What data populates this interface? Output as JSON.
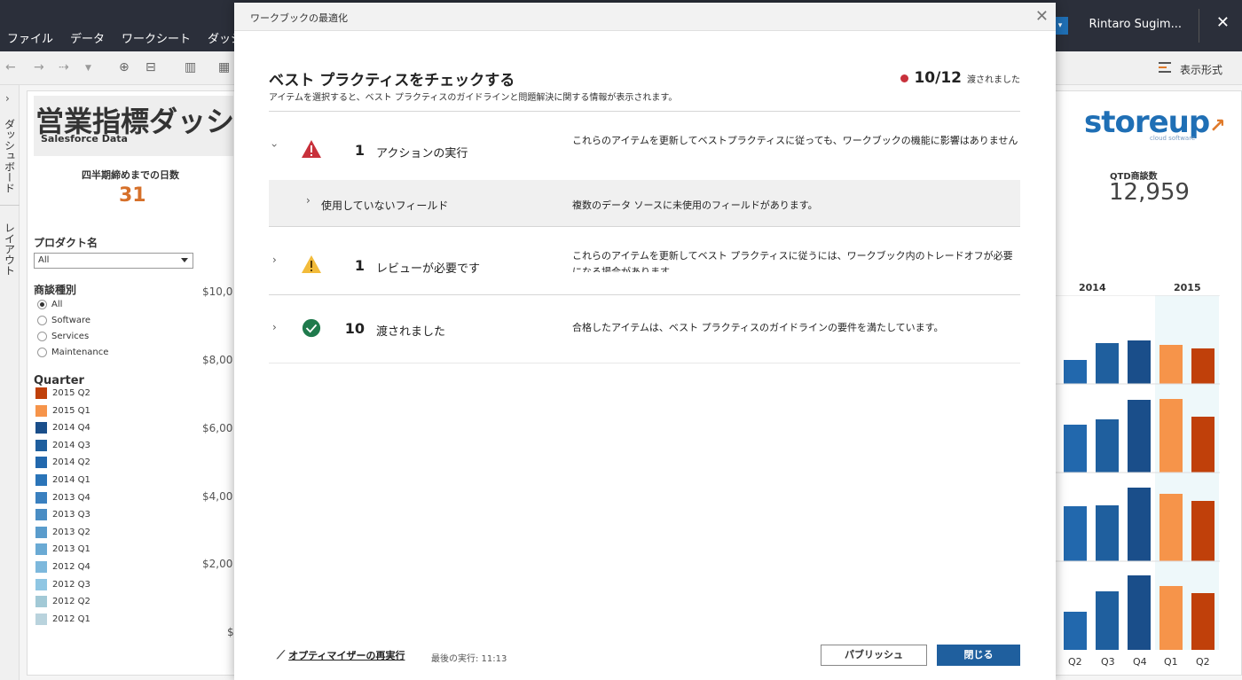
{
  "menubar": {
    "items": [
      "ファイル",
      "データ",
      "ワークシート",
      "ダッシ"
    ],
    "user": "Rintaro Sugim...",
    "close_glyph": "✕"
  },
  "toolbar": {
    "format_label": "表示形式"
  },
  "sidetabs": {
    "dashboard": "ダッシュボード",
    "layout": "レイアウト"
  },
  "dashboard": {
    "title": "営業指標ダッシュ",
    "subtitle": "Salesforce Data",
    "kpi_days_label": "四半期締めまでの日数",
    "kpi_days_value": "31",
    "product_filter_label": "プロダクト名",
    "product_filter_value": "All",
    "deal_type_label": "商談種別",
    "deal_types": [
      "All",
      "Software",
      "Services",
      "Maintenance"
    ],
    "deal_type_selected": "All",
    "quarter_label": "Quarter",
    "quarters": [
      {
        "label": "2015 Q2",
        "color": "#c0400a"
      },
      {
        "label": "2015 Q1",
        "color": "#f6944a"
      },
      {
        "label": "2014 Q4",
        "color": "#1a4e8a"
      },
      {
        "label": "2014 Q3",
        "color": "#1f5f9e"
      },
      {
        "label": "2014 Q2",
        "color": "#2268ad"
      },
      {
        "label": "2014 Q1",
        "color": "#2a74b8"
      },
      {
        "label": "2013 Q4",
        "color": "#3a80bf"
      },
      {
        "label": "2013 Q3",
        "color": "#4a8dc4"
      },
      {
        "label": "2013 Q2",
        "color": "#5a9ccc"
      },
      {
        "label": "2013 Q1",
        "color": "#6aaad4"
      },
      {
        "label": "2012 Q4",
        "color": "#7db8dc"
      },
      {
        "label": "2012 Q3",
        "color": "#8fc6e3"
      },
      {
        "label": "2012 Q2",
        "color": "#a2c9d6"
      },
      {
        "label": "2012 Q1",
        "color": "#b9d3dd"
      }
    ],
    "y_ticks": [
      "$10,0",
      "$8,00",
      "$6,00",
      "$4,00",
      "$2,00",
      "$"
    ],
    "logo_main": "storeup",
    "logo_sub": "cloud software",
    "qtd_label": "QTD商談数",
    "qtd_value": "12,959",
    "years": [
      "2014",
      "2015"
    ],
    "quarter_ticks": [
      "Q2",
      "Q3",
      "Q4",
      "Q1",
      "Q2"
    ]
  },
  "chart_data": {
    "type": "bar",
    "categories": [
      "Q2",
      "Q3",
      "Q4",
      "Q1",
      "Q2"
    ],
    "series": [
      {
        "values": [
          27,
          46,
          49,
          44,
          40
        ]
      },
      {
        "values": [
          54,
          60,
          82,
          83,
          63
        ]
      },
      {
        "values": [
          62,
          63,
          83,
          76,
          68
        ]
      },
      {
        "values": [
          43,
          66,
          84,
          72,
          64
        ]
      }
    ],
    "colors": [
      "#2268ad",
      "#1f5f9e",
      "#1a4e8a",
      "#f6944a",
      "#c0400a"
    ]
  },
  "dialog": {
    "title": "ワークブックの最適化",
    "heading": "ベスト プラクティスをチェックする",
    "subheading": "アイテムを選択すると、ベスト プラクティスのガイドラインと問題解決に関する情報が表示されます。",
    "score": "10/12",
    "score_label": "渡されました",
    "rows": [
      {
        "count": "1",
        "name": "アクションの実行",
        "desc": "これらのアイテムを更新してベストプラクティスに従っても、ワークブックの機能に影響はありません"
      },
      {
        "count": "1",
        "name": "レビューが必要です",
        "desc": "これらのアイテムを更新してベスト プラクティスに従うには、ワークブック内のトレードオフが必要になる場合があります"
      },
      {
        "count": "10",
        "name": "渡されました",
        "desc": "合格したアイテムは、ベスト プラクティスのガイドラインの要件を満たしています。"
      }
    ],
    "subrow": {
      "name": "使用していないフィールド",
      "desc": "複数のデータ ソースに未使用のフィールドがあります。"
    },
    "rerun_label": "オプティマイザーの再実行",
    "last_run": "最後の実行: 11:13",
    "publish_label": "パブリッシュ",
    "close_label": "閉じる"
  }
}
